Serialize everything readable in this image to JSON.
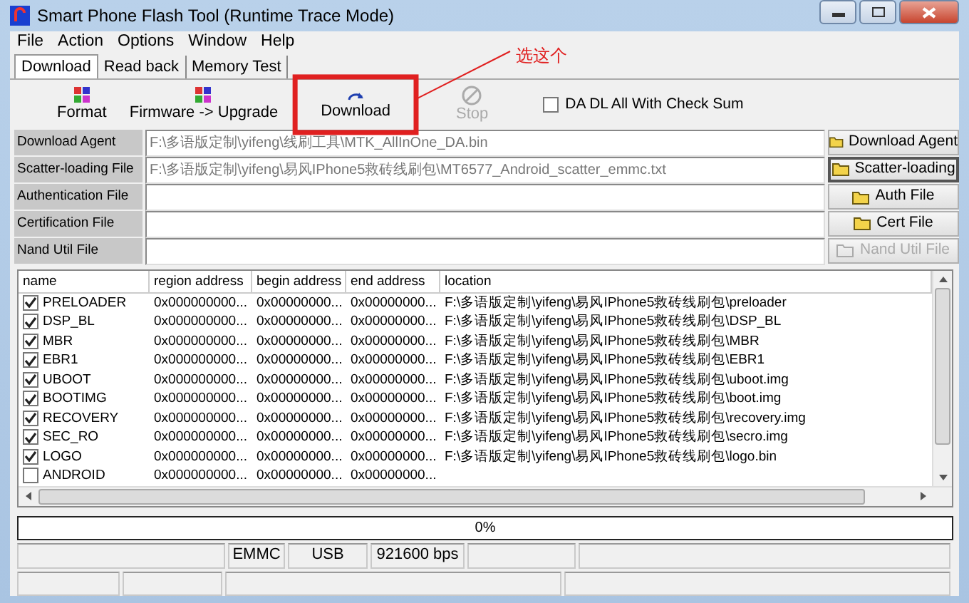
{
  "window": {
    "title": "Smart Phone Flash Tool (Runtime Trace Mode)"
  },
  "menu": [
    "File",
    "Action",
    "Options",
    "Window",
    "Help"
  ],
  "tabs": [
    {
      "label": "Download",
      "selected": true
    },
    {
      "label": "Read back",
      "selected": false
    },
    {
      "label": "Memory Test",
      "selected": false
    }
  ],
  "toolbar": [
    {
      "label": "Format",
      "kind": "format",
      "disabled": false
    },
    {
      "label": "Firmware -> Upgrade",
      "kind": "format",
      "disabled": false
    },
    {
      "label": "Download",
      "kind": "download",
      "disabled": false
    },
    {
      "label": "Stop",
      "kind": "stop",
      "disabled": true
    }
  ],
  "checksum": {
    "label": "DA DL All With Check Sum",
    "checked": false
  },
  "files": [
    {
      "label": "Download Agent",
      "value": "F:\\多语版定制\\yifeng\\线刷工具\\MTK_AllInOne_DA.bin",
      "button": "Download Agent",
      "disabled": false,
      "focused": false
    },
    {
      "label": "Scatter-loading File",
      "value": "F:\\多语版定制\\yifeng\\易风IPhone5救砖线刷包\\MT6577_Android_scatter_emmc.txt",
      "button": "Scatter-loading",
      "disabled": false,
      "focused": true
    },
    {
      "label": "Authentication File",
      "button": "Auth File",
      "disabled": false,
      "focused": false
    },
    {
      "label": "Certification File",
      "button": "Cert File",
      "disabled": false,
      "focused": false
    },
    {
      "label": "Nand Util File",
      "button": "Nand Util File",
      "disabled": true,
      "focused": false
    }
  ],
  "table": {
    "columns": [
      "name",
      "region address",
      "begin address",
      "end address",
      "location"
    ],
    "rows": [
      {
        "checked": true,
        "name": "PRELOADER",
        "region": "0x000000000...",
        "begin": "0x00000000...",
        "end": "0x00000000...",
        "location": "F:\\多语版定制\\yifeng\\易风IPhone5救砖线刷包\\preloader"
      },
      {
        "checked": true,
        "name": "DSP_BL",
        "region": "0x000000000...",
        "begin": "0x00000000...",
        "end": "0x00000000...",
        "location": "F:\\多语版定制\\yifeng\\易风IPhone5救砖线刷包\\DSP_BL"
      },
      {
        "checked": true,
        "name": "MBR",
        "region": "0x000000000...",
        "begin": "0x00000000...",
        "end": "0x00000000...",
        "location": "F:\\多语版定制\\yifeng\\易风IPhone5救砖线刷包\\MBR"
      },
      {
        "checked": true,
        "name": "EBR1",
        "region": "0x000000000...",
        "begin": "0x00000000...",
        "end": "0x00000000...",
        "location": "F:\\多语版定制\\yifeng\\易风IPhone5救砖线刷包\\EBR1"
      },
      {
        "checked": true,
        "name": "UBOOT",
        "region": "0x000000000...",
        "begin": "0x00000000...",
        "end": "0x00000000...",
        "location": "F:\\多语版定制\\yifeng\\易风IPhone5救砖线刷包\\uboot.img"
      },
      {
        "checked": true,
        "name": "BOOTIMG",
        "region": "0x000000000...",
        "begin": "0x00000000...",
        "end": "0x00000000...",
        "location": "F:\\多语版定制\\yifeng\\易风IPhone5救砖线刷包\\boot.img"
      },
      {
        "checked": true,
        "name": "RECOVERY",
        "region": "0x000000000...",
        "begin": "0x00000000...",
        "end": "0x00000000...",
        "location": "F:\\多语版定制\\yifeng\\易风IPhone5救砖线刷包\\recovery.img"
      },
      {
        "checked": true,
        "name": "SEC_RO",
        "region": "0x000000000...",
        "begin": "0x00000000...",
        "end": "0x00000000...",
        "location": "F:\\多语版定制\\yifeng\\易风IPhone5救砖线刷包\\secro.img"
      },
      {
        "checked": true,
        "name": "LOGO",
        "region": "0x000000000...",
        "begin": "0x00000000...",
        "end": "0x00000000...",
        "location": "F:\\多语版定制\\yifeng\\易风IPhone5救砖线刷包\\logo.bin"
      },
      {
        "checked": false,
        "name": "ANDROID",
        "region": "0x000000000...",
        "begin": "0x00000000...",
        "end": "0x00000000..."
      }
    ]
  },
  "progress": {
    "level": 0,
    "text": "0%"
  },
  "status_bar": [
    "EMMC",
    "USB",
    "921600 bps"
  ],
  "annotation": {
    "text": "选这个"
  }
}
